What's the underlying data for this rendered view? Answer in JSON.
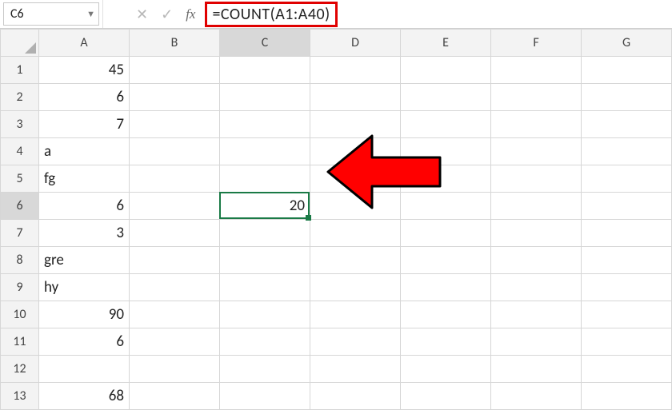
{
  "name_box": "C6",
  "formula": "=COUNT(A1:A40)",
  "columns": [
    "A",
    "B",
    "C",
    "D",
    "E",
    "F",
    "G"
  ],
  "rows": [
    {
      "n": "1",
      "A": {
        "v": "45",
        "t": "num"
      }
    },
    {
      "n": "2",
      "A": {
        "v": "6",
        "t": "num"
      }
    },
    {
      "n": "3",
      "A": {
        "v": "7",
        "t": "num"
      }
    },
    {
      "n": "4",
      "A": {
        "v": "a",
        "t": "txt"
      }
    },
    {
      "n": "5",
      "A": {
        "v": "fg",
        "t": "txt"
      }
    },
    {
      "n": "6",
      "A": {
        "v": "6",
        "t": "num"
      },
      "C": {
        "v": "20",
        "t": "num"
      }
    },
    {
      "n": "7",
      "A": {
        "v": "3",
        "t": "num"
      }
    },
    {
      "n": "8",
      "A": {
        "v": "gre",
        "t": "txt"
      }
    },
    {
      "n": "9",
      "A": {
        "v": "hy",
        "t": "txt"
      }
    },
    {
      "n": "10",
      "A": {
        "v": "90",
        "t": "num"
      }
    },
    {
      "n": "11",
      "A": {
        "v": "6",
        "t": "num"
      }
    },
    {
      "n": "12"
    },
    {
      "n": "13",
      "A": {
        "v": "68",
        "t": "num"
      }
    }
  ],
  "active": {
    "col": "C",
    "row": "6"
  },
  "icons": {
    "cancel": "✕",
    "enter": "✓",
    "fx": "fx",
    "dropdown": "▼"
  },
  "chart_data": {
    "type": "table",
    "active_cell": "C6",
    "formula": "=COUNT(A1:A40)",
    "result": 20,
    "column_A": [
      45,
      6,
      7,
      "a",
      "fg",
      6,
      3,
      "gre",
      "hy",
      90,
      6,
      null,
      68
    ]
  }
}
